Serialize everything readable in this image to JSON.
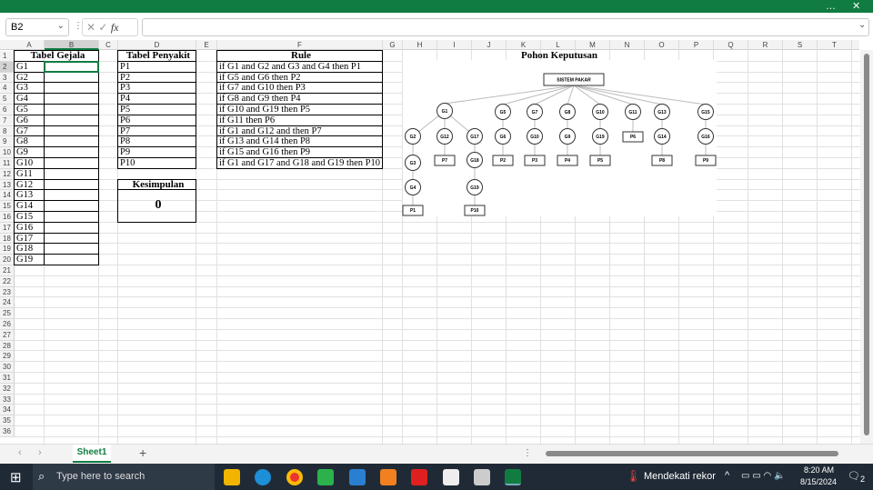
{
  "window": {
    "more_icon": "…",
    "close_icon": "✕"
  },
  "formula_bar": {
    "name_box": "B2",
    "fx": "fx",
    "formula": ""
  },
  "columns": [
    "A",
    "B",
    "C",
    "D",
    "E",
    "F",
    "G",
    "H",
    "I",
    "J",
    "K",
    "L",
    "M",
    "N",
    "O",
    "P",
    "Q",
    "R",
    "S",
    "T"
  ],
  "rows": 36,
  "gejala": {
    "title": "Tabel Gejala",
    "items": [
      "G1",
      "G2",
      "G3",
      "G4",
      "G5",
      "G6",
      "G7",
      "G8",
      "G9",
      "G10",
      "G11",
      "G12",
      "G13",
      "G14",
      "G15",
      "G16",
      "G17",
      "G18",
      "G19"
    ]
  },
  "penyakit": {
    "title": "Tabel Penyakit",
    "items": [
      "P1",
      "P2",
      "P3",
      "P4",
      "P5",
      "P6",
      "P7",
      "P8",
      "P9",
      "P10"
    ]
  },
  "rules": {
    "title": "Rule",
    "items": [
      "if G1 and G2 and G3 and G4 then P1",
      "if G5 and G6 then P2",
      "if G7 and G10 then P3",
      "if G8 and G9 then P4",
      "if G10 and G19 then P5",
      "if G11 then P6",
      "if G1 and G12 and then P7",
      "if G13 and G14 then P8",
      "if G15 and G16 then P9",
      "if G1 and G17 and G18 and G19 then P10"
    ]
  },
  "kesimpulan": {
    "title": "Kesimpulan",
    "value": "0"
  },
  "tree": {
    "title": "Pohon Keputusan",
    "root": "SISTEM PAKAR",
    "nodes": [
      "G1",
      "G5",
      "G7",
      "G8",
      "G10",
      "G11",
      "G13",
      "G15",
      "G2",
      "G12",
      "G17",
      "G6",
      "G10",
      "G9",
      "G19",
      "P6",
      "G14",
      "G16",
      "G3",
      "P7",
      "G18",
      "P2",
      "P3",
      "P4",
      "P5",
      "P8",
      "P9",
      "G4",
      "G19",
      "P1",
      "P10"
    ]
  },
  "sheet_tab": "Sheet1",
  "taskbar": {
    "search": "Type here to search",
    "weather": "Mendekati rekor",
    "time": "8:20 AM",
    "date": "8/15/2024",
    "notif": "2"
  }
}
